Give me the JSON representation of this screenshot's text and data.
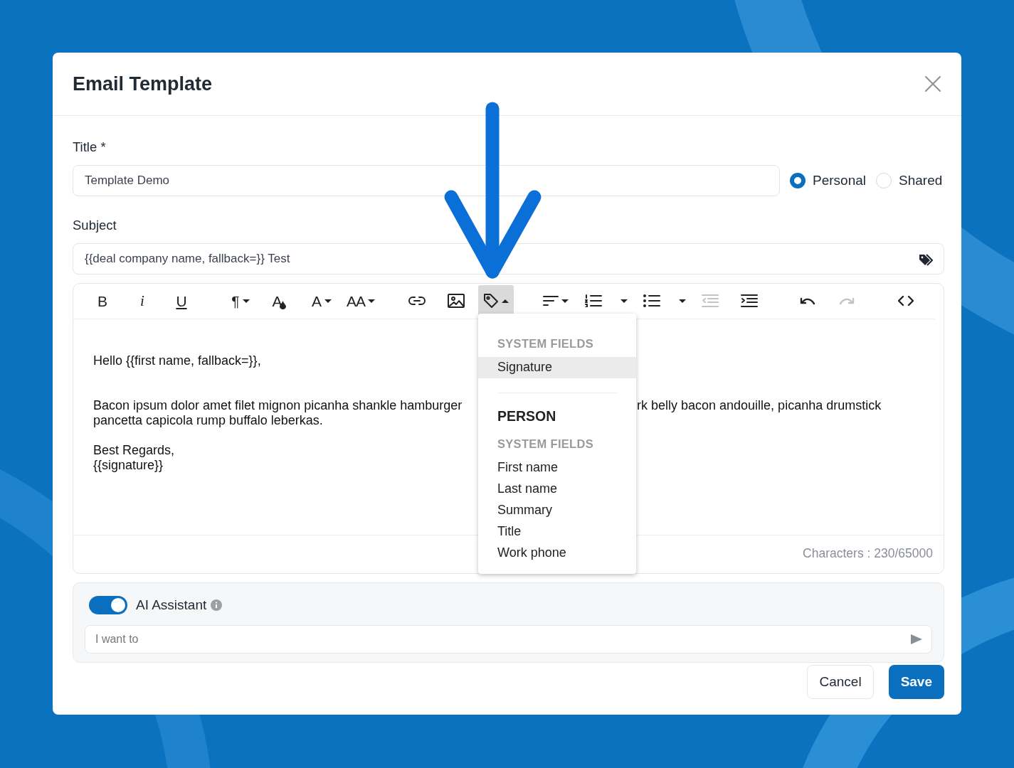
{
  "dialog": {
    "title": "Email Template"
  },
  "title_field": {
    "label": "Title *",
    "value": "Template Demo"
  },
  "visibility": [
    {
      "label": "Personal",
      "selected": true
    },
    {
      "label": "Shared",
      "selected": false
    }
  ],
  "subject_field": {
    "label": "Subject",
    "value": "{{deal company name, fallback=}} Test"
  },
  "toolbar": [
    {
      "kind": "bold",
      "label": "B",
      "active": false,
      "disabled": false
    },
    {
      "kind": "italic",
      "label": "i",
      "active": false,
      "disabled": false
    },
    {
      "kind": "underline",
      "label": "U",
      "active": false,
      "disabled": false
    },
    {
      "kind": "paragraph",
      "label": "¶",
      "active": false,
      "disabled": false
    },
    {
      "kind": "fontcolor",
      "label": "A",
      "active": false,
      "disabled": false
    },
    {
      "kind": "font",
      "label": "A",
      "active": false,
      "disabled": false
    },
    {
      "kind": "size",
      "label": "AA",
      "active": false,
      "disabled": false
    },
    {
      "kind": "link",
      "active": false,
      "disabled": false
    },
    {
      "kind": "image",
      "active": false,
      "disabled": false
    },
    {
      "kind": "tag",
      "active": true,
      "disabled": false
    },
    {
      "kind": "align",
      "active": false,
      "disabled": false
    },
    {
      "kind": "ol",
      "active": false,
      "disabled": false
    },
    {
      "kind": "list-caret",
      "active": false,
      "disabled": false
    },
    {
      "kind": "ul",
      "active": false,
      "disabled": false
    },
    {
      "kind": "list-caret",
      "active": false,
      "disabled": false
    },
    {
      "kind": "outdent",
      "active": false,
      "disabled": true
    },
    {
      "kind": "indent",
      "active": false,
      "disabled": false
    },
    {
      "kind": "undo",
      "active": false,
      "disabled": false
    },
    {
      "kind": "redo",
      "active": false,
      "disabled": true
    },
    {
      "kind": "code",
      "active": false,
      "disabled": false
    }
  ],
  "editor": {
    "greeting": "Hello {{first name, fallback=}},",
    "paragraph_line_1_left": "Bacon ipsum dolor amet filet mignon picanha shankle hamburger",
    "paragraph_line_1_right": "rk belly bacon andouille, picanha drumstick",
    "paragraph_line_2": "pancetta capicola rump buffalo leberkas.",
    "closing": "Best Regards,",
    "signature": "{{signature}}",
    "character_count": "Characters : 230/65000"
  },
  "field_menu": [
    {
      "kind": "subheading",
      "text": "SYSTEM FIELDS"
    },
    {
      "kind": "item",
      "text": "Signature",
      "selected": true
    },
    {
      "kind": "divider"
    },
    {
      "kind": "group",
      "text": "PERSON"
    },
    {
      "kind": "subheading",
      "text": "SYSTEM FIELDS"
    },
    {
      "kind": "item",
      "text": "First name",
      "selected": false
    },
    {
      "kind": "item",
      "text": "Last name",
      "selected": false
    },
    {
      "kind": "item",
      "text": "Summary",
      "selected": false
    },
    {
      "kind": "item",
      "text": "Title",
      "selected": false
    },
    {
      "kind": "item",
      "text": "Work phone",
      "selected": false
    }
  ],
  "ai_assistant": {
    "label": "AI Assistant",
    "on": true,
    "placeholder": "I want to"
  },
  "buttons": [
    {
      "kind": "secondary",
      "label": "Cancel"
    },
    {
      "kind": "primary",
      "label": "Save"
    }
  ]
}
